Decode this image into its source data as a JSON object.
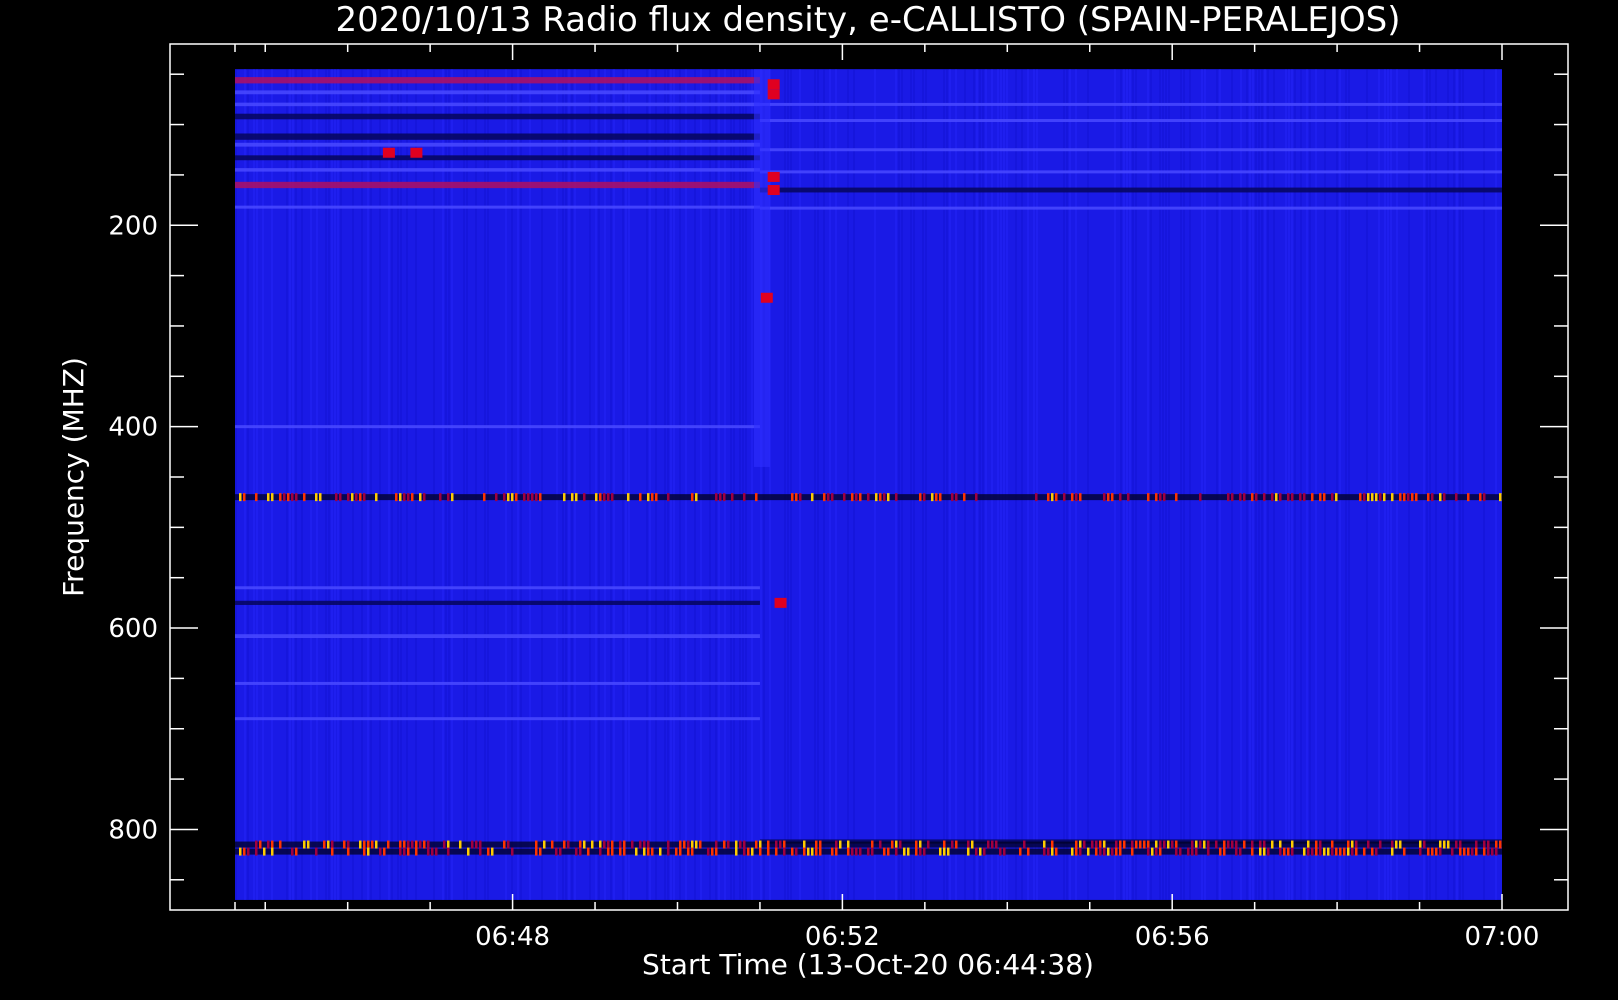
{
  "chart_data": {
    "type": "heatmap",
    "title": "2020/10/13  Radio flux density, e-CALLISTO (SPAIN-PERALEJOS)",
    "xlabel": "Start Time (13-Oct-20 06:44:38)",
    "ylabel": "Frequency (MHZ)",
    "x_start_time": "06:44:38",
    "x_end_time": "07:00:00",
    "xlim_time": [
      "06:44:38",
      "07:00:00"
    ],
    "ylim": [
      880,
      20
    ],
    "y_data_range": [
      45,
      870
    ],
    "y_inverted": true,
    "x_ticks": [
      {
        "time": "06:48",
        "label": "06:48"
      },
      {
        "time": "06:52",
        "label": "06:52"
      },
      {
        "time": "06:56",
        "label": "06:56"
      },
      {
        "time": "07:00",
        "label": "07:00"
      }
    ],
    "x_minor_tick_minutes": 1,
    "y_ticks": [
      {
        "value": 200,
        "label": "200"
      },
      {
        "value": 400,
        "label": "400"
      },
      {
        "value": 600,
        "label": "600"
      },
      {
        "value": 800,
        "label": "800"
      }
    ],
    "y_minor_tick_step": 50,
    "event_time": "06:51:00",
    "colormap": [
      "#000000",
      "#0000c8",
      "#3a3aff",
      "#ff0000",
      "#ff8800",
      "#ffe000"
    ],
    "background_color": "#1a1ae6",
    "bands": [
      {
        "freq": 56,
        "intensity": 0.9,
        "segment": "pre"
      },
      {
        "freq": 68,
        "intensity": 0.55,
        "segment": "pre"
      },
      {
        "freq": 80,
        "intensity": 0.5,
        "segment": "pre"
      },
      {
        "freq": 92,
        "intensity": -0.8,
        "segment": "pre"
      },
      {
        "freq": 112,
        "intensity": -0.9,
        "segment": "pre"
      },
      {
        "freq": 120,
        "intensity": 0.55,
        "segment": "pre"
      },
      {
        "freq": 133,
        "intensity": -0.7,
        "segment": "pre"
      },
      {
        "freq": 145,
        "intensity": 0.5,
        "segment": "pre"
      },
      {
        "freq": 160,
        "intensity": 0.9,
        "segment": "pre"
      },
      {
        "freq": 182,
        "intensity": 0.35,
        "segment": "pre"
      },
      {
        "freq": 400,
        "intensity": 0.3,
        "segment": "pre"
      },
      {
        "freq": 560,
        "intensity": 0.35,
        "segment": "pre"
      },
      {
        "freq": 575,
        "intensity": -0.6,
        "segment": "pre"
      },
      {
        "freq": 608,
        "intensity": 0.55,
        "segment": "pre"
      },
      {
        "freq": 655,
        "intensity": 0.3,
        "segment": "pre"
      },
      {
        "freq": 690,
        "intensity": 0.3,
        "segment": "pre"
      },
      {
        "freq": 80,
        "intensity": 0.3,
        "segment": "post"
      },
      {
        "freq": 96,
        "intensity": 0.35,
        "segment": "post"
      },
      {
        "freq": 125,
        "intensity": 0.3,
        "segment": "post"
      },
      {
        "freq": 147,
        "intensity": 0.3,
        "segment": "post"
      },
      {
        "freq": 165,
        "intensity": -0.7,
        "segment": "post"
      },
      {
        "freq": 183,
        "intensity": 0.25,
        "segment": "post"
      },
      {
        "freq": 470,
        "intensity": 1.0,
        "segment": "all",
        "speckled": true
      },
      {
        "freq": 812,
        "intensity": -0.6,
        "segment": "post"
      },
      {
        "freq": 815,
        "intensity": 1.0,
        "segment": "all",
        "speckled": true
      },
      {
        "freq": 822,
        "intensity": 0.8,
        "segment": "all",
        "speckled": true
      }
    ],
    "hot_spots": [
      {
        "time": "06:51:10",
        "freq": 60
      },
      {
        "time": "06:51:10",
        "freq": 70
      },
      {
        "time": "06:51:10",
        "freq": 152
      },
      {
        "time": "06:51:10",
        "freq": 165
      },
      {
        "time": "06:51:05",
        "freq": 272
      },
      {
        "time": "06:51:15",
        "freq": 575
      },
      {
        "time": "06:46:30",
        "freq": 128
      },
      {
        "time": "06:46:50",
        "freq": 128
      }
    ]
  }
}
